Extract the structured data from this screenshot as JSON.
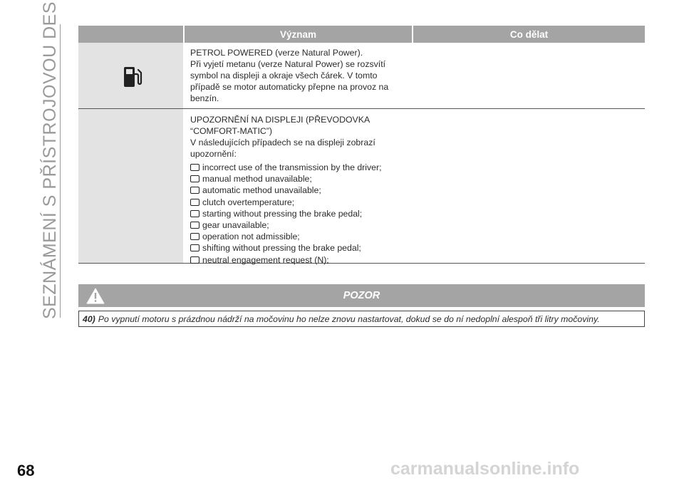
{
  "side_title": "SEZNÁMENÍ S PŘÍSTROJOVOU DESKOU",
  "page_number": "68",
  "watermark": "carmanualsonline.info",
  "table": {
    "headers": {
      "icon": "",
      "meaning": "Význam",
      "action": "Co dělat"
    },
    "row1": {
      "icon": "fuel-pump-icon",
      "lines": [
        "PETROL POWERED (verze Natural Power).",
        "Při vyjetí metanu (verze Natural Power) se rozsvítí",
        "symbol na displeji a okraje všech čárek. V tomto",
        "případě se motor automaticky přepne na provoz na",
        "benzín."
      ]
    },
    "row2": {
      "lines": [
        "UPOZORNĚNÍ NA DISPLEJI (PŘEVODOVKA",
        "“COMFORT-MATIC”)",
        "V následujících případech se na displeji zobrazí",
        "upozornění:"
      ],
      "bullets": [
        "incorrect use of the transmission by the driver;",
        "manual method unavailable;",
        "automatic method unavailable;",
        "clutch overtemperature;",
        "starting without pressing the brake pedal;",
        "gear unavailable;",
        "operation not admissible;",
        "shifting without pressing the brake pedal;",
        "neutral engagement request (N);"
      ]
    }
  },
  "warning": {
    "icon": "warning-triangle-icon",
    "title": "POZOR",
    "number": "40)",
    "text": "Po vypnutí motoru s prázdnou nádrží na močovinu ho nelze znovu nastartovat, dokud se do ní nedoplní alespoň tři litry močoviny."
  },
  "colors": {
    "header_gray": "#a4a4a4",
    "icon_cell": "#e3e3e3",
    "side_text": "#9a9a9a"
  }
}
